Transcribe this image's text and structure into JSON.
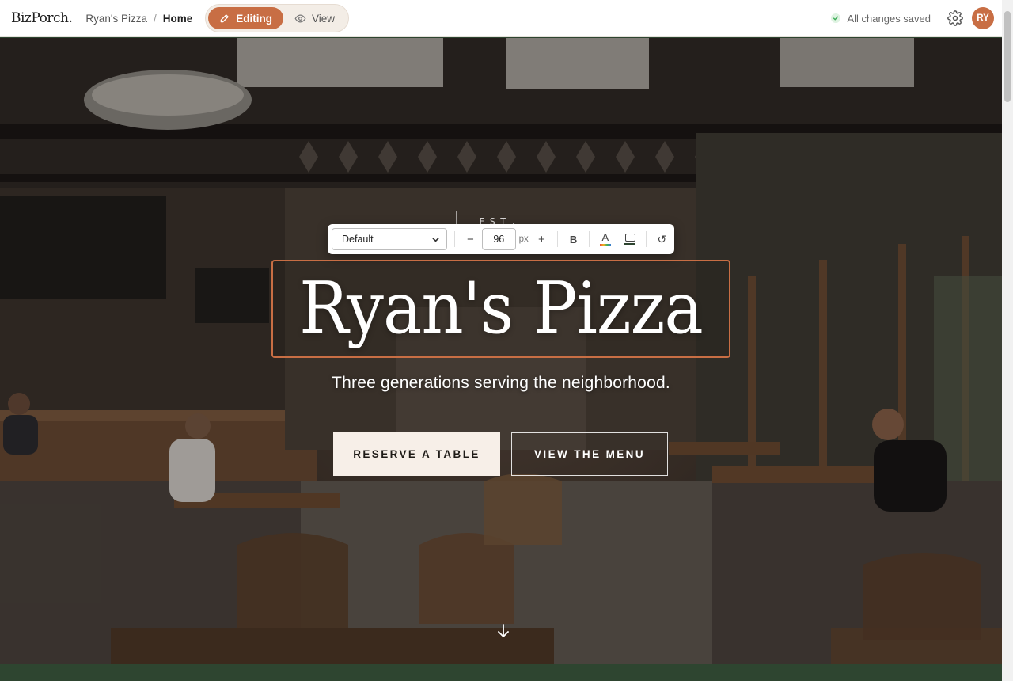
{
  "app": {
    "logo": "BizPorch."
  },
  "breadcrumb": {
    "site": "Ryan's Pizza",
    "separator": "/",
    "page": "Home"
  },
  "mode": {
    "editing_label": "Editing",
    "view_label": "View",
    "active": "editing"
  },
  "status": {
    "saved_text": "All changes saved"
  },
  "user": {
    "initials": "RY"
  },
  "format_toolbar": {
    "font_option": "Default",
    "decrease_label": "−",
    "size_value": "96",
    "size_unit": "px",
    "increase_label": "+",
    "bold_label": "B",
    "text_color_label": "A",
    "reset_label": "↺"
  },
  "hero": {
    "badge": "EST. 1987",
    "title": "Ryan's Pizza",
    "subtitle": "Three generations serving the neighborhood.",
    "primary_cta": "RESERVE A TABLE",
    "secondary_cta": "VIEW THE MENU"
  },
  "colors": {
    "accent": "#c86e44",
    "saved_check": "#3fae5a",
    "footer_section": "#2e4530",
    "cta_primary_bg": "#f7efe8"
  },
  "icons": {
    "editing": "pencil-icon",
    "view": "eye-icon",
    "saved": "check-icon",
    "settings": "gear-icon",
    "scroll": "arrow-down-icon"
  }
}
